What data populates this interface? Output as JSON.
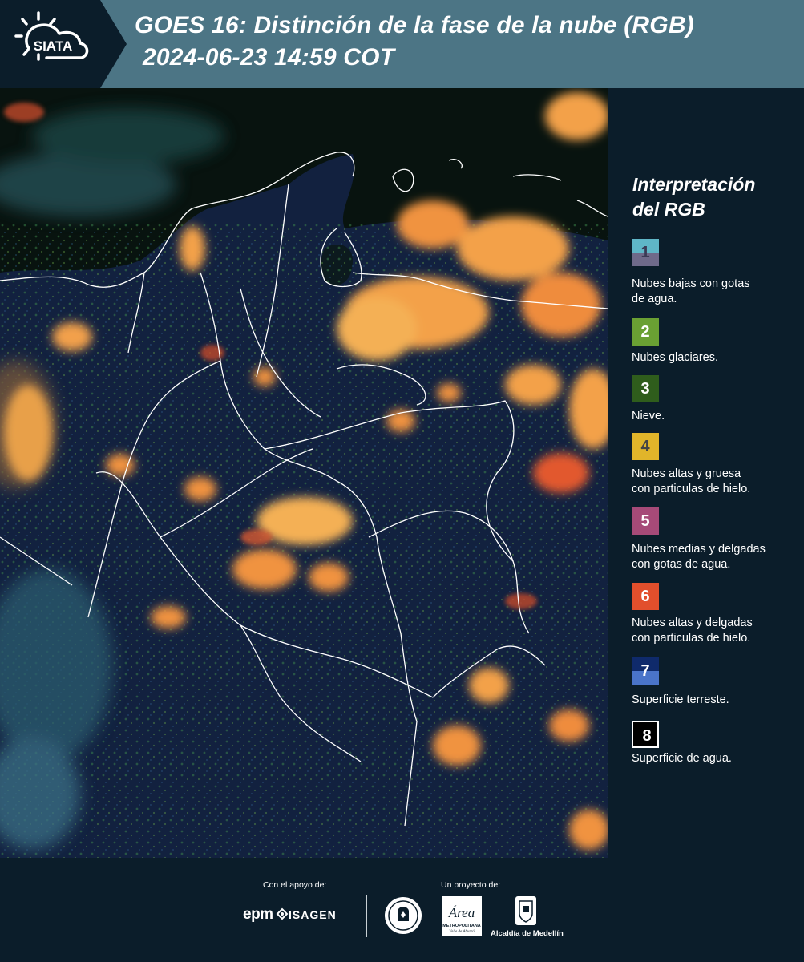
{
  "header": {
    "logo_text": "SIATA",
    "title_line1": "GOES 16: Distinción de la fase de la nube (RGB)",
    "title_line2": "2024-06-23 14:59 COT",
    "bg_color": "#4c7585"
  },
  "legend": {
    "title_line1": "Interpretación",
    "title_line2": "del RGB",
    "items": [
      {
        "num": "1",
        "label_line1": "Nubes bajas con gotas",
        "label_line2": "de agua.",
        "color_top": "#5fb6c7",
        "color_bottom": "#6f6a8a"
      },
      {
        "num": "2",
        "label_line1": "Nubes glaciares.",
        "label_line2": "",
        "color_top": "#6aa033",
        "color_bottom": "#6aa033"
      },
      {
        "num": "3",
        "label_line1": "Nieve.",
        "label_line2": "",
        "color_top": "#2f5d1c",
        "color_bottom": "#2f5d1c"
      },
      {
        "num": "4",
        "label_line1": "Nubes altas y gruesa",
        "label_line2": "con particulas de hielo.",
        "color_top": "#e1b52a",
        "color_bottom": "#e1b52a"
      },
      {
        "num": "5",
        "label_line1": "Nubes medias y delgadas",
        "label_line2": "con gotas de agua.",
        "color_top": "#a64a78",
        "color_bottom": "#a64a78"
      },
      {
        "num": "6",
        "label_line1": "Nubes altas y delgadas",
        "label_line2": "con particulas de hielo.",
        "color_top": "#e24f2c",
        "color_bottom": "#e24f2c"
      },
      {
        "num": "7",
        "label_line1": "Superficie terreste.",
        "label_line2": "",
        "color_top": "#0f2a6b",
        "color_bottom": "#4a74c9"
      },
      {
        "num": "8",
        "label_line1": "Superficie de agua.",
        "label_line2": "",
        "color_top": "#000000",
        "color_bottom": "#000000"
      }
    ]
  },
  "footer": {
    "support_caption": "Con el apoyo de:",
    "project_caption": "Un proyecto de:",
    "epm_logo": "epm",
    "isagen_logo": "ISAGEN",
    "area_logo": "Área",
    "area_sub1": "METROPOLITANA",
    "area_sub2": "Valle de Aburrá",
    "alcaldia_logo": "Alcaldía de Medellín"
  },
  "map": {
    "land_color": "#12213f",
    "ocean_color": "#08130f",
    "boundary_color": "#ffffff",
    "cloud_color_main": "#f3a14a",
    "cloud_color_edge": "#e2582f",
    "cloud_color_low": "#6aa06a"
  }
}
